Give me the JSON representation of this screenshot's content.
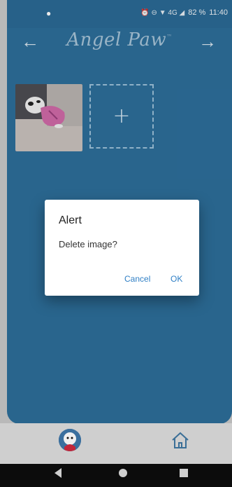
{
  "statusbar": {
    "left_icon": "chat-bubble-icon",
    "right_icons": "⏰ ⊖ ▼ 4G ◢",
    "battery": "82 %",
    "time": "11:40"
  },
  "header": {
    "logo_text": "Angel Paw",
    "logo_tm": "™",
    "back_arrow": "←",
    "forward_arrow": "→"
  },
  "gallery": {
    "add_symbol": "+"
  },
  "dialog": {
    "title": "Alert",
    "message": "Delete image?",
    "cancel_label": "Cancel",
    "ok_label": "OK"
  },
  "colors": {
    "app_background": "#2d6e9a",
    "dialog_button": "#2f7fc5"
  }
}
